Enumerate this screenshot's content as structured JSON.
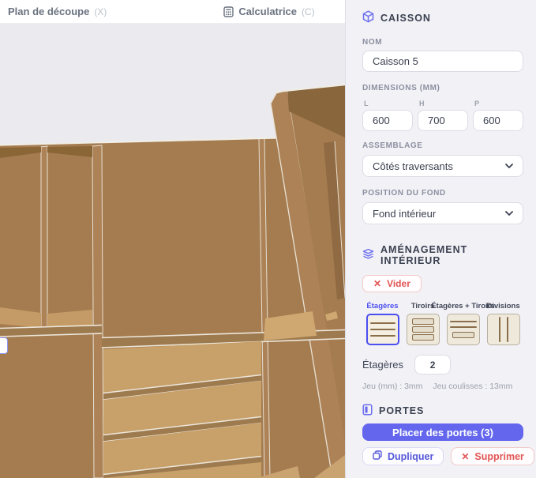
{
  "topbar": {
    "tabs": [
      {
        "label": "Plan de découpe",
        "shortcut": "(X)"
      },
      {
        "label": "Calculatrice",
        "shortcut": "(C)",
        "icon": "calculator-icon"
      }
    ]
  },
  "panel": {
    "caisson": {
      "title": "CAISSON",
      "icon": "cube-icon"
    },
    "nom": {
      "label": "NOM",
      "value": "Caisson 5"
    },
    "dimensions": {
      "label": "DIMENSIONS (MM)",
      "fields": [
        {
          "label": "L",
          "value": "600"
        },
        {
          "label": "H",
          "value": "700"
        },
        {
          "label": "P",
          "value": "600"
        }
      ]
    },
    "assemblage": {
      "label": "ASSEMBLAGE",
      "value": "Côtés traversants"
    },
    "position_fond": {
      "label": "POSITION DU FOND",
      "value": "Fond intérieur"
    },
    "amenagement": {
      "title": "AMÉNAGEMENT INTÉRIEUR",
      "icon": "layers-icon",
      "vider_label": "Vider",
      "tiles": [
        {
          "label": "Étagères",
          "selected": true
        },
        {
          "label": "Tiroirs",
          "selected": false
        },
        {
          "label": "Étagères + Tiroirs",
          "selected": false
        },
        {
          "label": "Divisions",
          "selected": false
        }
      ],
      "etageres_label": "Étagères",
      "etageres_value": "2",
      "jeu_info": "Jeu (mm) : 3mm",
      "jeu_coulisses_info": "Jeu coulisses : 13mm"
    },
    "portes": {
      "title": "PORTES",
      "icon": "door-icon",
      "placer_label": "Placer des portes (3)",
      "dupliquer_label": "Dupliquer",
      "supprimer_label": "Supprimer"
    }
  },
  "colors": {
    "accent": "#6467ee",
    "danger": "#e25555",
    "wood_back": "#a57c50",
    "wood_front": "#ad8257",
    "wood_shelf_top": "#c7a06a",
    "wood_shadow": "#8a6536",
    "viewport_bg": "#eaeaef",
    "panel_bg": "#f2f1f6"
  }
}
